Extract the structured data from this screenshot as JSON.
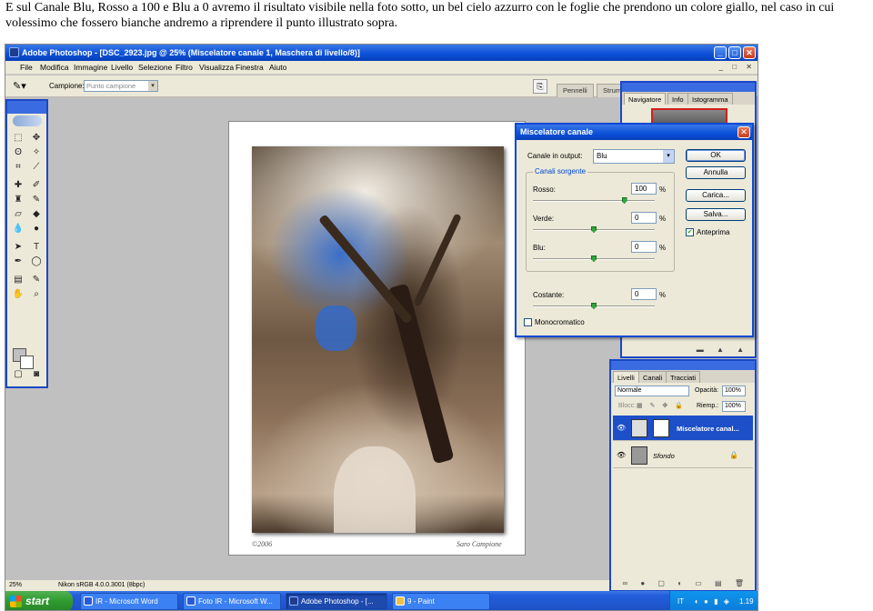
{
  "caption": "E sul Canale Blu, Rosso a 100 e Blu a 0 avremo il risultato visibile nella foto sotto, un bel cielo azzurro con le foglie che prendono un colore giallo, nel caso in cui volessimo che fossero bianche andremo a riprendere il punto illustrato sopra.",
  "window": {
    "title": "Adobe Photoshop - [DSC_2923.jpg @ 25% (Miscelatore canale 1, Maschera di livello/8)]",
    "controls": [
      "_",
      "□",
      "✕"
    ]
  },
  "menu": [
    "File",
    "Modifica",
    "Immagine",
    "Livello",
    "Selezione",
    "Filtro",
    "Visualizza",
    "Finestra",
    "Aiuto"
  ],
  "menu_window_controls": "_ □ ✕",
  "options_bar": {
    "label": "Campione:",
    "select_value": "Punto campione",
    "well_tabs": [
      "Pennelli",
      "Strum"
    ]
  },
  "document": {
    "signature_left": "©2006",
    "signature_right": "Saro Campione"
  },
  "navigator_palette": {
    "tabs": [
      "Navigatore",
      "Info",
      "Istogramma"
    ]
  },
  "layers_palette": {
    "tabs": [
      "Livelli",
      "Canali",
      "Tracciati"
    ],
    "blend_mode": "Normale",
    "opacity_label": "Opacità:",
    "opacity_value": "100%",
    "lock_label": "Blocc:",
    "fill_label": "Riemp.:",
    "fill_value": "100%",
    "layers": [
      {
        "name": "Miscelatore canal...",
        "selected": true
      },
      {
        "name": "Sfondo",
        "selected": false
      }
    ]
  },
  "channel_mixer": {
    "title": "Miscelatore canale",
    "output_label": "Canale in output:",
    "output_value": "Blu",
    "source_legend": "Canali sorgente",
    "sliders": [
      {
        "label": "Rosso:",
        "value": "100",
        "percent": 100
      },
      {
        "label": "Verde:",
        "value": "0",
        "percent": 0
      },
      {
        "label": "Blu:",
        "value": "0",
        "percent": 0
      }
    ],
    "constant": {
      "label": "Costante:",
      "value": "0",
      "percent": 0
    },
    "pct_symbol": "%",
    "buttons": [
      "OK",
      "Annulla",
      "Carica...",
      "Salva..."
    ],
    "preview_label": "Anteprima",
    "preview_checked": true,
    "mono_label": "Monocromatico",
    "mono_checked": false
  },
  "status_bar": {
    "zoom": "25%",
    "profile": "Nikon sRGB 4.0.0.3001 (8bpc)"
  },
  "taskbar": {
    "start_label": "start",
    "tasks": [
      {
        "label": "IR - Microsoft Word",
        "active": false
      },
      {
        "label": "Foto IR - Microsoft W...",
        "active": false
      },
      {
        "label": "Adobe Photoshop - [...",
        "active": true
      },
      {
        "label": "9 - Paint",
        "active": false
      }
    ],
    "lang": "IT",
    "clock": "1.19"
  }
}
